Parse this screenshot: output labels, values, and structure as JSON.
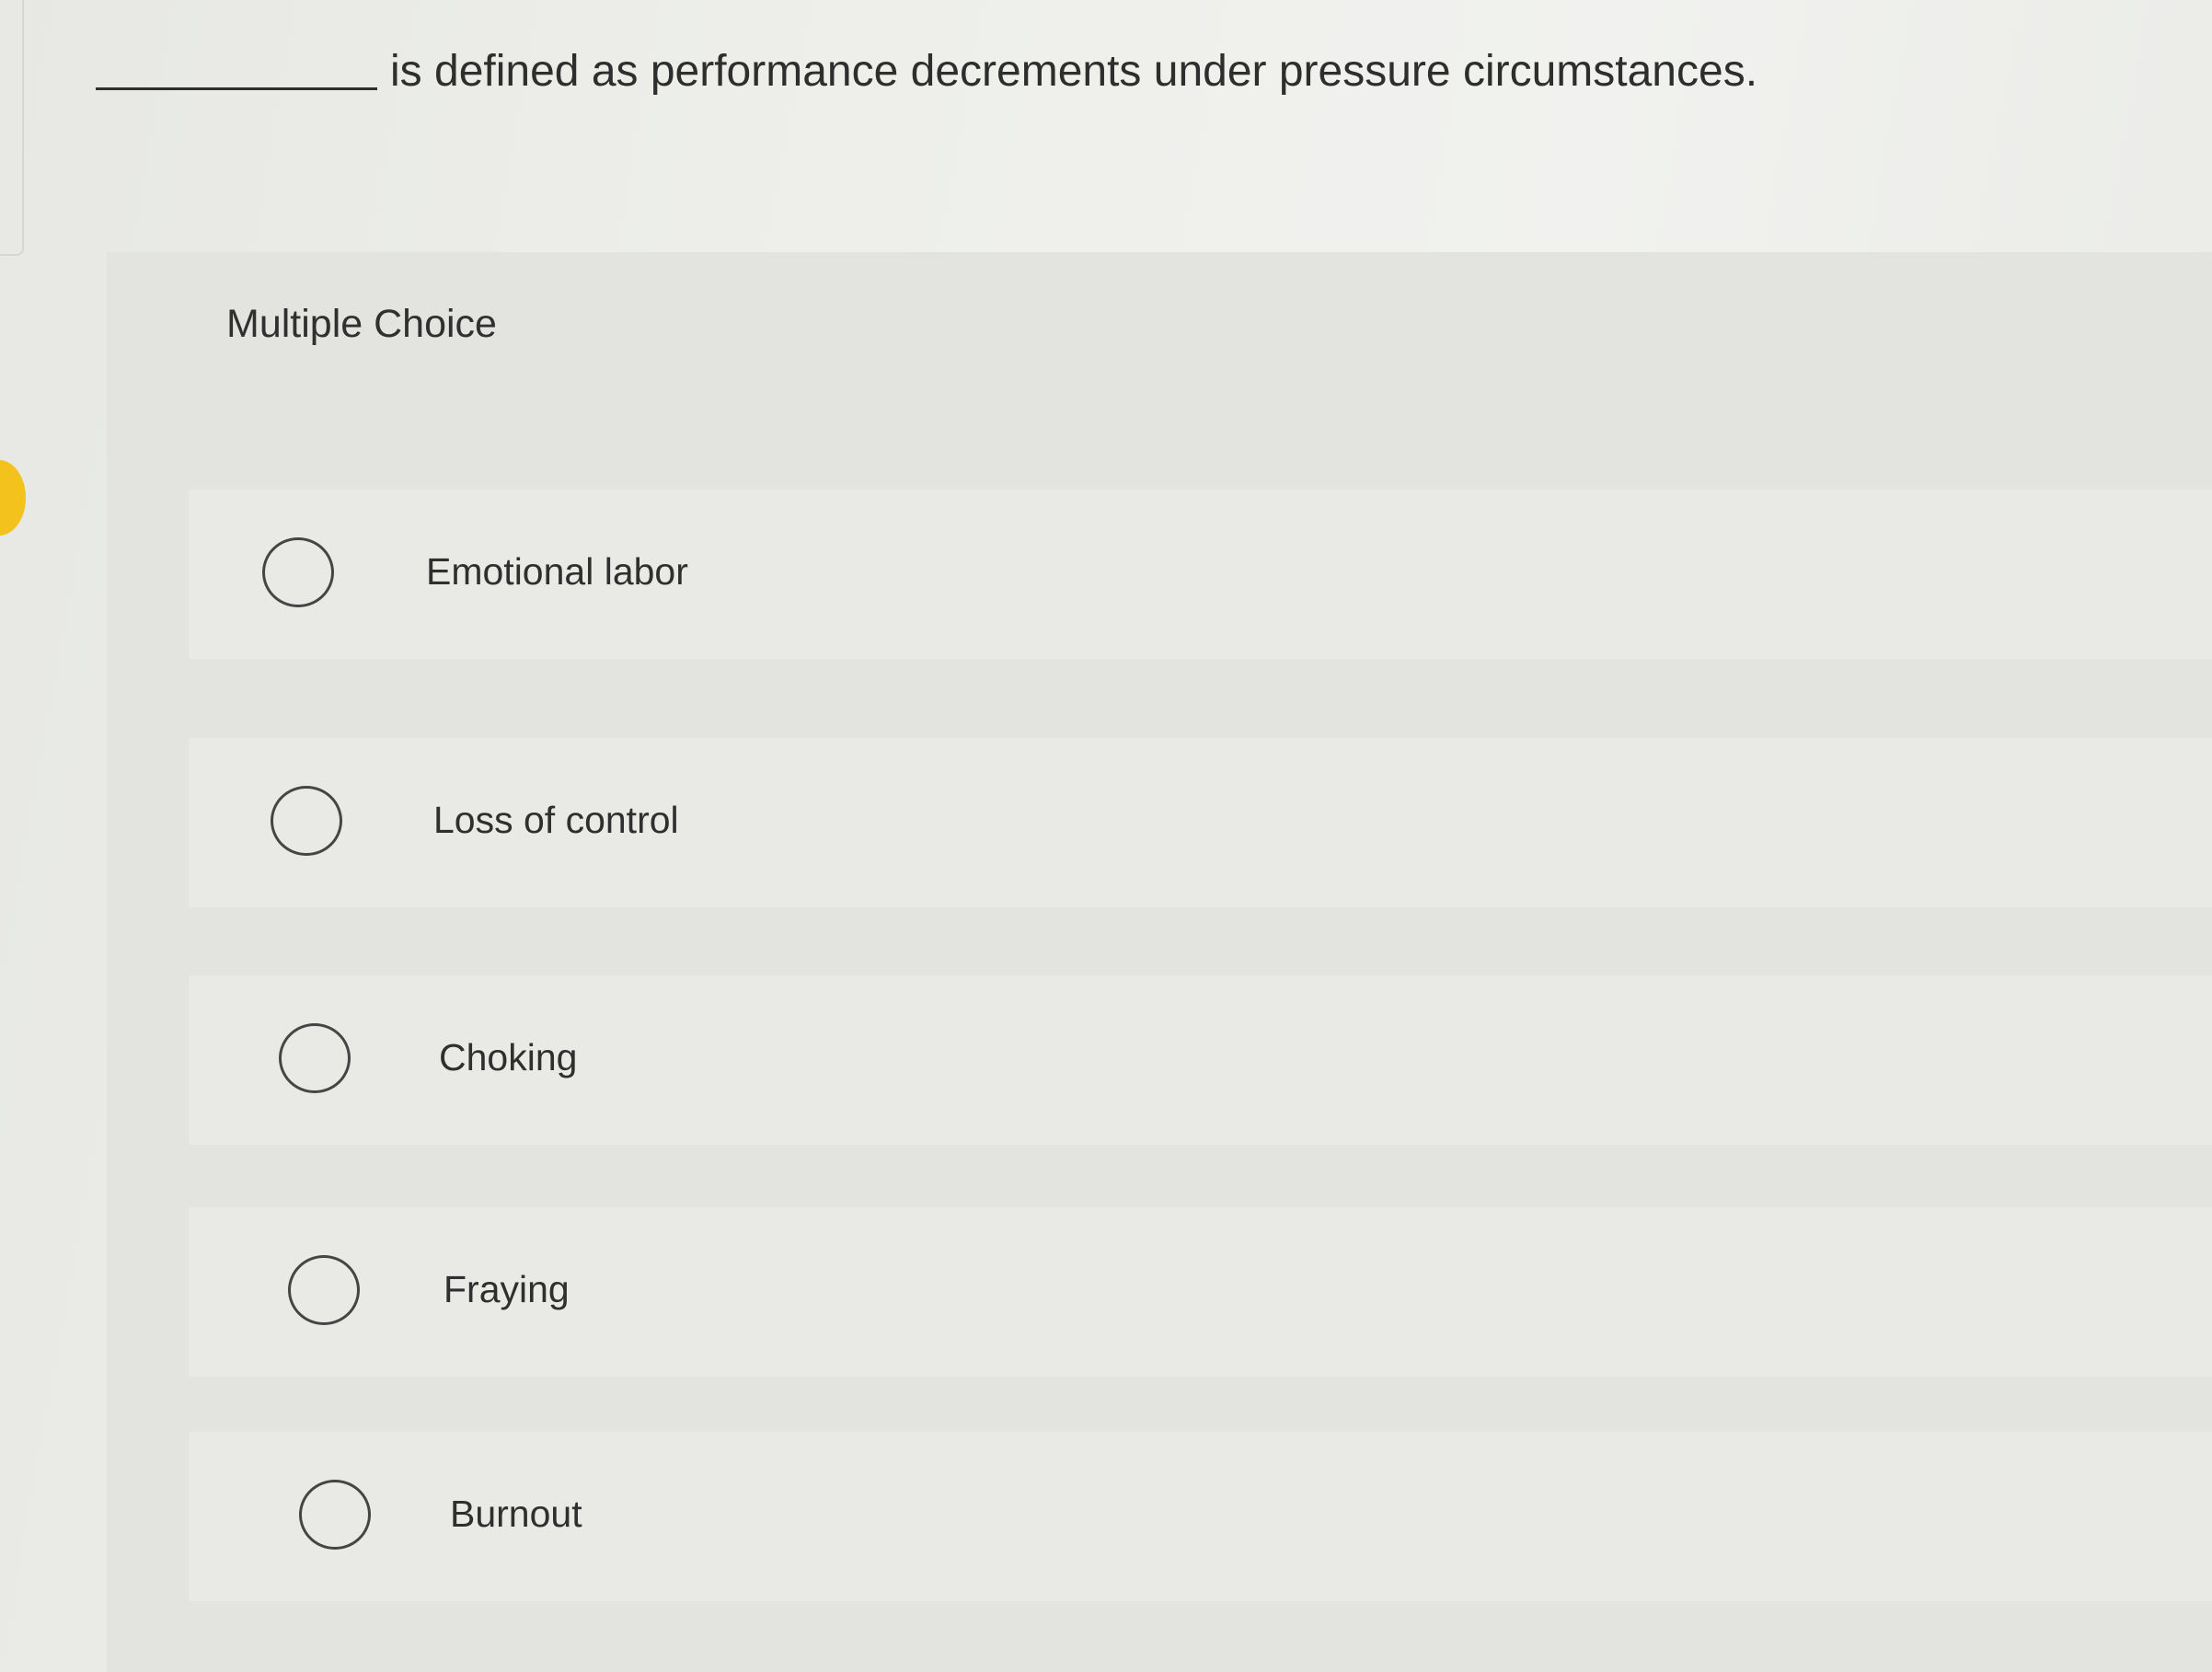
{
  "question": {
    "text": "is defined as performance decrements under pressure circumstances."
  },
  "choice_section": {
    "label": "Multiple Choice"
  },
  "options": [
    {
      "label": "Emotional labor",
      "selected": false
    },
    {
      "label": "Loss of control",
      "selected": false
    },
    {
      "label": "Choking",
      "selected": false
    },
    {
      "label": "Fraying",
      "selected": false
    },
    {
      "label": "Burnout",
      "selected": false
    }
  ],
  "colors": {
    "marker": "#f3c21d",
    "panel": "#e3e4e0",
    "text": "#2e2e2e"
  },
  "icons": {
    "marker": "yellow-dot-icon",
    "radio": "radio-circle-icon"
  }
}
